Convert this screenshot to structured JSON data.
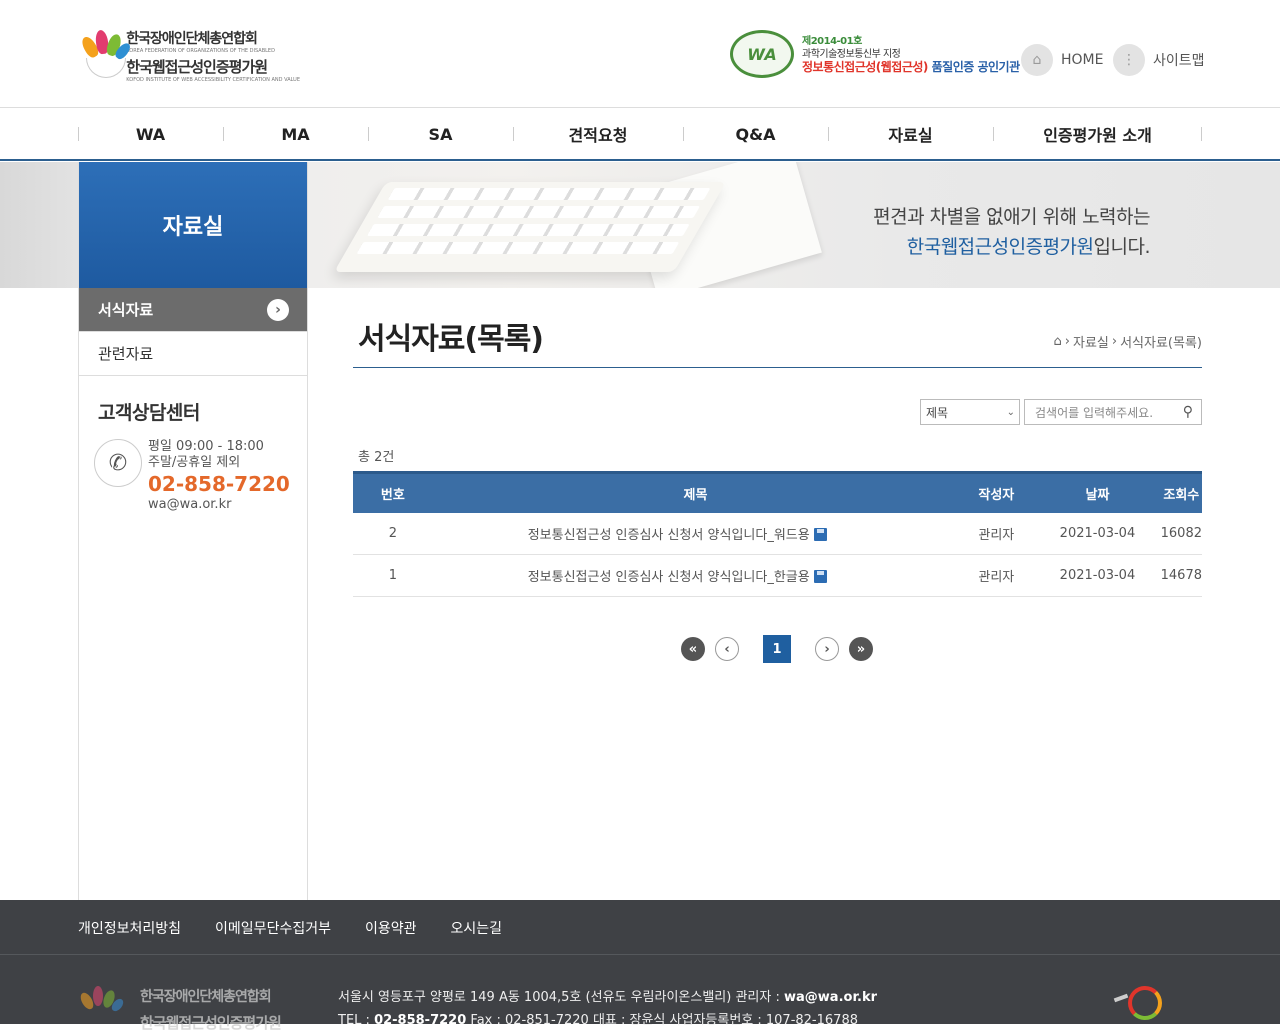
{
  "header": {
    "logo_line1": "한국장애인단체총연합회",
    "logo_sub1": "KOREA FEDERATION OF ORGANIZATIONS OF THE DISABLED",
    "logo_line2": "한국웹접근성인증평가원",
    "logo_sub2": "KOFOD INSTITUTE OF WEB ACCESSIBILITY CERTIFICATION AND VALUE",
    "cert_badge": "WA",
    "cert_no": "제2014-01호",
    "cert_org": "과학기술정보통신부 지정",
    "cert_main_a": "정보통신접근성",
    "cert_main_b": "(웹접근성)",
    "cert_main_c": "품질인증 공인기관",
    "home_label": "HOME",
    "sitemap_label": "사이트맵"
  },
  "gnb": [
    {
      "label": "WA"
    },
    {
      "label": "MA"
    },
    {
      "label": "SA"
    },
    {
      "label": "견적요청"
    },
    {
      "label": "Q&A"
    },
    {
      "label": "자료실"
    },
    {
      "label": "인증평가원 소개"
    }
  ],
  "visual": {
    "line1": "편견과 차별을 없애기 위해 노력하는",
    "line2_highlight": "한국웹접근성인증평가원",
    "line2_rest": "입니다."
  },
  "lnb": {
    "title": "자료실",
    "items": [
      {
        "label": "서식자료",
        "active": true
      },
      {
        "label": "관련자료",
        "active": false
      }
    ],
    "cs_title": "고객상담센터",
    "cs_hours": "평일 09:00 - 18:00",
    "cs_off": "주말/공휴일 제외",
    "cs_tel": "02-858-7220",
    "cs_email": "wa@wa.or.kr"
  },
  "content": {
    "title": "서식자료(목록)",
    "breadcrumb": [
      "자료실",
      "서식자료(목록)"
    ],
    "search_select": "제목",
    "search_placeholder": "검색어를 입력해주세요.",
    "total": "총 2건",
    "columns": [
      "번호",
      "제목",
      "작성자",
      "날짜",
      "조회수"
    ],
    "rows": [
      {
        "no": "2",
        "title": "정보통신접근성 인증심사 신청서 양식입니다_워드용",
        "author": "관리자",
        "date": "2021-03-04",
        "views": "16082"
      },
      {
        "no": "1",
        "title": "정보통신접근성 인증심사 신청서 양식입니다_한글용",
        "author": "관리자",
        "date": "2021-03-04",
        "views": "14678"
      }
    ],
    "pagination": {
      "current": "1"
    }
  },
  "footer": {
    "links": [
      "개인정보처리방침",
      "이메일무단수집거부",
      "이용약관",
      "오시는길"
    ],
    "address_line": "서울시 영등포구 양평로 149 A동 1004,5호 (선유도 우림라이온스밸리) 관리자 :",
    "admin_email": "wa@wa.or.kr",
    "tel_label": "TEL :",
    "tel": "02-858-7220",
    "fax_etc": "Fax : 02-851-7220 대표 : 장윤식 사업자등록번호 : 107-82-16788",
    "logo_line1": "한국장애인단체총연합회",
    "logo_line2": "한국웹접근성인증평가원"
  },
  "colors": {
    "primary": "#2c5f8f",
    "table_header": "#3b6ea5",
    "accent_orange": "#e4682a",
    "footer_bg": "#3f4145"
  }
}
